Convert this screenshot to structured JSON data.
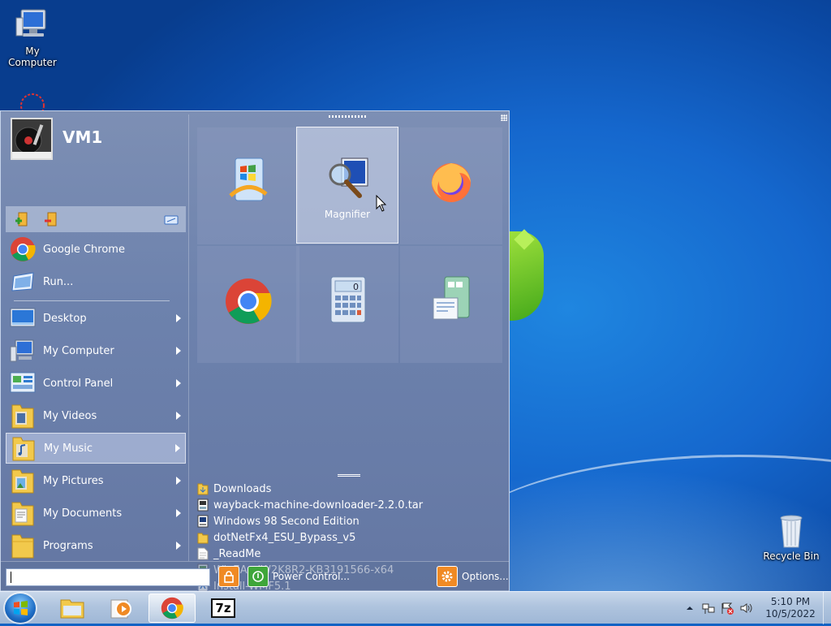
{
  "desktop": {
    "icons": [
      {
        "label": "My Computer",
        "icon": "computer-icon"
      },
      {
        "label": "Recycle Bin",
        "icon": "recycle-bin-icon"
      }
    ]
  },
  "start_menu": {
    "user_name": "VM1",
    "quick_buttons": [
      {
        "icon": "add-shortcut-icon"
      },
      {
        "icon": "remove-shortcut-icon"
      },
      {
        "icon": "folder-view-icon"
      }
    ],
    "pinned": [
      {
        "label": "Google Chrome",
        "icon": "chrome-icon"
      },
      {
        "label": "Run...",
        "icon": "run-icon"
      }
    ],
    "items": [
      {
        "label": "Desktop",
        "icon": "desktop-icon",
        "submenu": true
      },
      {
        "label": "My Computer",
        "icon": "computer-icon",
        "submenu": true
      },
      {
        "label": "Control Panel",
        "icon": "control-panel-icon",
        "submenu": true
      },
      {
        "label": "My Videos",
        "icon": "videos-folder-icon",
        "submenu": true
      },
      {
        "label": "My Music",
        "icon": "music-folder-icon",
        "submenu": true,
        "selected": true
      },
      {
        "label": "My Pictures",
        "icon": "pictures-folder-icon",
        "submenu": true
      },
      {
        "label": "My Documents",
        "icon": "documents-folder-icon",
        "submenu": true
      },
      {
        "label": "Programs",
        "icon": "programs-folder-icon",
        "submenu": true
      }
    ],
    "tiles": [
      {
        "label": "",
        "icon": "windows-update-icon"
      },
      {
        "label": "Magnifier",
        "icon": "magnifier-icon",
        "hover": true
      },
      {
        "label": "",
        "icon": "firefox-icon"
      },
      {
        "label": "",
        "icon": "chrome-icon"
      },
      {
        "label": "",
        "icon": "calculator-icon"
      },
      {
        "label": "",
        "icon": "control-panel-tile-icon"
      }
    ],
    "recent": [
      {
        "label": "Downloads",
        "icon": "downloads-folder-icon"
      },
      {
        "label": "wayback-machine-downloader-2.2.0.tar",
        "icon": "archive-file-icon"
      },
      {
        "label": "Windows 98 Second Edition",
        "icon": "disk-image-icon"
      },
      {
        "label": "dotNetFx4_ESU_Bypass_v5",
        "icon": "folder-icon"
      },
      {
        "label": "_ReadMe",
        "icon": "text-file-icon"
      },
      {
        "label": "Win7AndW2K8R2-KB3191566-x64",
        "icon": "installer-icon"
      },
      {
        "label": "Install-WMF5.1",
        "icon": "script-icon"
      }
    ],
    "search": {
      "value": ""
    },
    "buttons": {
      "lock_icon": "lock-icon",
      "power_label": "Power Control...",
      "options_label": "Options..."
    }
  },
  "taskbar": {
    "apps": [
      {
        "icon": "file-explorer-icon",
        "active": false
      },
      {
        "icon": "media-player-icon",
        "active": false
      },
      {
        "icon": "chrome-icon",
        "active": true
      },
      {
        "icon": "7zip-icon",
        "label": "7z",
        "active": false
      }
    ],
    "tray_icons": [
      "show-hidden-icons-icon",
      "network-icon",
      "action-center-icon",
      "volume-icon"
    ],
    "time": "5:10 PM",
    "date": "10/5/2022"
  },
  "colors": {
    "desktop_blue": "#1567cd",
    "menu_bg": "#6d82ad",
    "accent_orange": "#f08a24",
    "accent_green": "#3fa63a"
  }
}
